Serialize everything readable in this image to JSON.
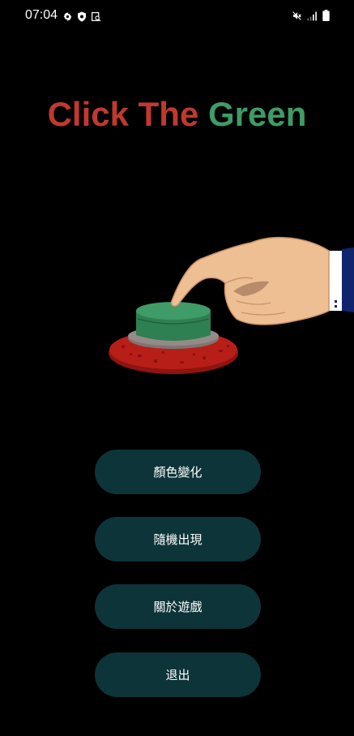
{
  "status_bar": {
    "time": "07:04",
    "left_icons": [
      "gear-icon",
      "shield-icon",
      "screenshot-icon"
    ],
    "right_icons": [
      "mute-icon",
      "signal-icon",
      "battery-icon"
    ]
  },
  "title": {
    "part1": "Click The",
    "part2": "Green",
    "part1_color": "#c0392f",
    "part2_color": "#3f9b67"
  },
  "illustration": {
    "name": "hand-pressing-green-button",
    "button_color": "#3f9b67",
    "base_color": "#b81e18"
  },
  "menu": {
    "items": [
      {
        "label": "顏色變化"
      },
      {
        "label": "隨機出現"
      },
      {
        "label": "關於遊戲"
      },
      {
        "label": "退出"
      }
    ],
    "button_color": "#0d3438"
  }
}
